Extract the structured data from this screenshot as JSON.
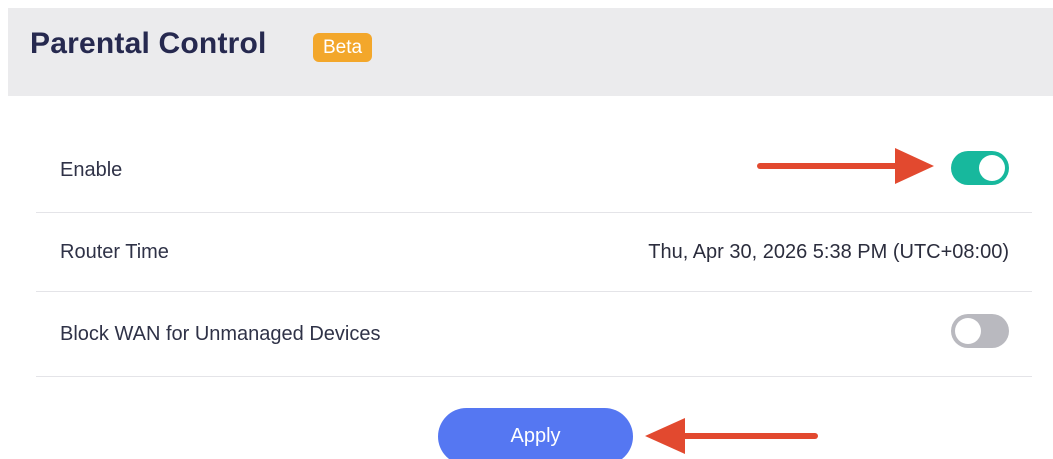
{
  "header": {
    "title": "Parental Control",
    "badge": "Beta"
  },
  "settings": [
    {
      "label": "Enable",
      "type": "toggle",
      "enabled": true
    },
    {
      "label": "Router Time",
      "type": "text",
      "value": "Thu, Apr 30, 2026 5:38 PM (UTC+08:00)"
    },
    {
      "label": "Block WAN for Unmanaged Devices",
      "type": "toggle",
      "enabled": false
    }
  ],
  "actions": {
    "apply_label": "Apply"
  },
  "colors": {
    "toggle_on": "#17b89d",
    "toggle_off": "#b9b9bf",
    "badge": "#f3a72b",
    "apply_button": "#5577f2",
    "annotation_arrow": "#e2492f"
  }
}
